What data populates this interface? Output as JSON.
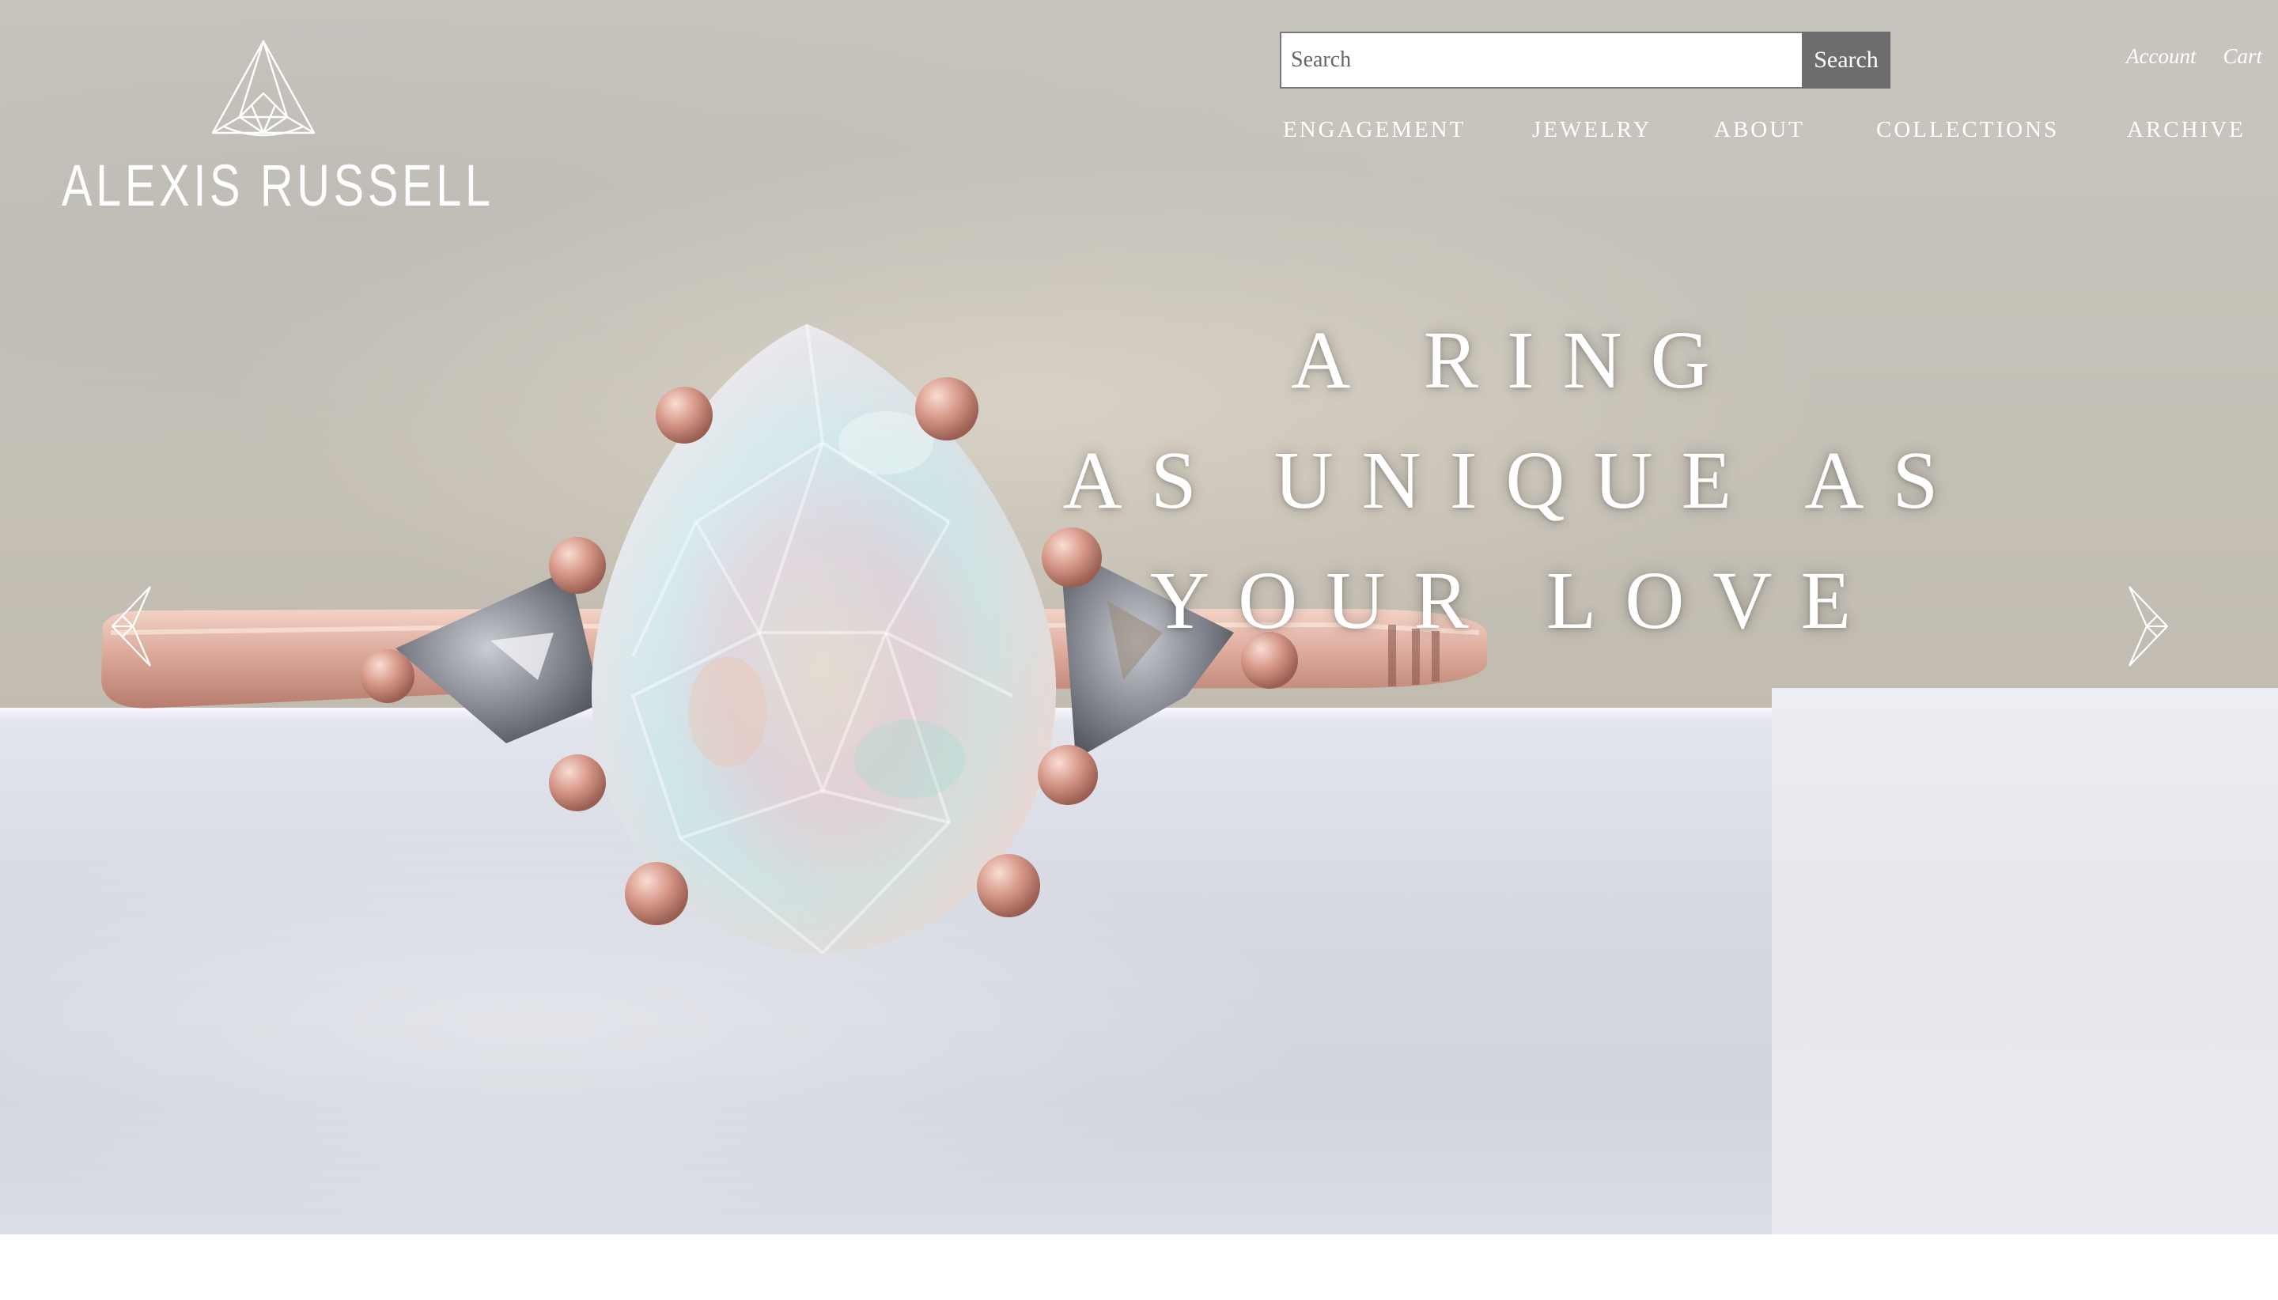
{
  "brand": {
    "name": "ALEXIS RUSSELL",
    "logo_icon": "triangle-diamond-icon"
  },
  "search": {
    "placeholder": "Search",
    "button_label": "Search"
  },
  "account_links": {
    "account": "Account",
    "cart": "Cart"
  },
  "nav": {
    "items": [
      "ENGAGEMENT",
      "JEWELRY",
      "ABOUT",
      "COLLECTIONS",
      "ARCHIVE"
    ]
  },
  "hero": {
    "lines": [
      "A RING",
      "AS UNIQUE AS",
      "YOUR LOVE"
    ],
    "prev_icon": "chevron-left-icon",
    "next_icon": "chevron-right-icon"
  }
}
